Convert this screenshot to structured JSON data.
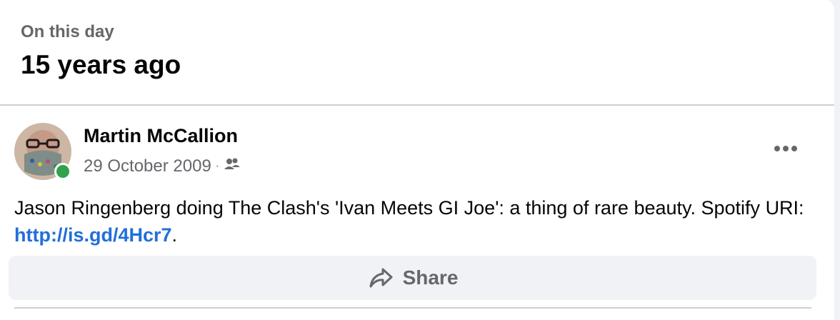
{
  "memory_header": {
    "kicker": "On this day",
    "title": "15 years ago"
  },
  "post": {
    "author": "Martin McCallion",
    "date": "29 October 2009",
    "separator": "·",
    "audience_icon": "friends-icon",
    "more_icon": "more-options-icon",
    "text_prefix": "Jason Ringenberg doing The Clash's 'Ivan Meets GI Joe': a thing of rare beauty. Spotify URI: ",
    "link_text": "http://is.gd/4Hcr7",
    "text_suffix": "."
  },
  "actions": {
    "share_label": "Share",
    "share_icon": "share-arrow-icon"
  },
  "colors": {
    "link": "#216fdb",
    "secondary_text": "#65676b",
    "presence": "#31a24c",
    "button_bg": "#f0f2f5"
  }
}
